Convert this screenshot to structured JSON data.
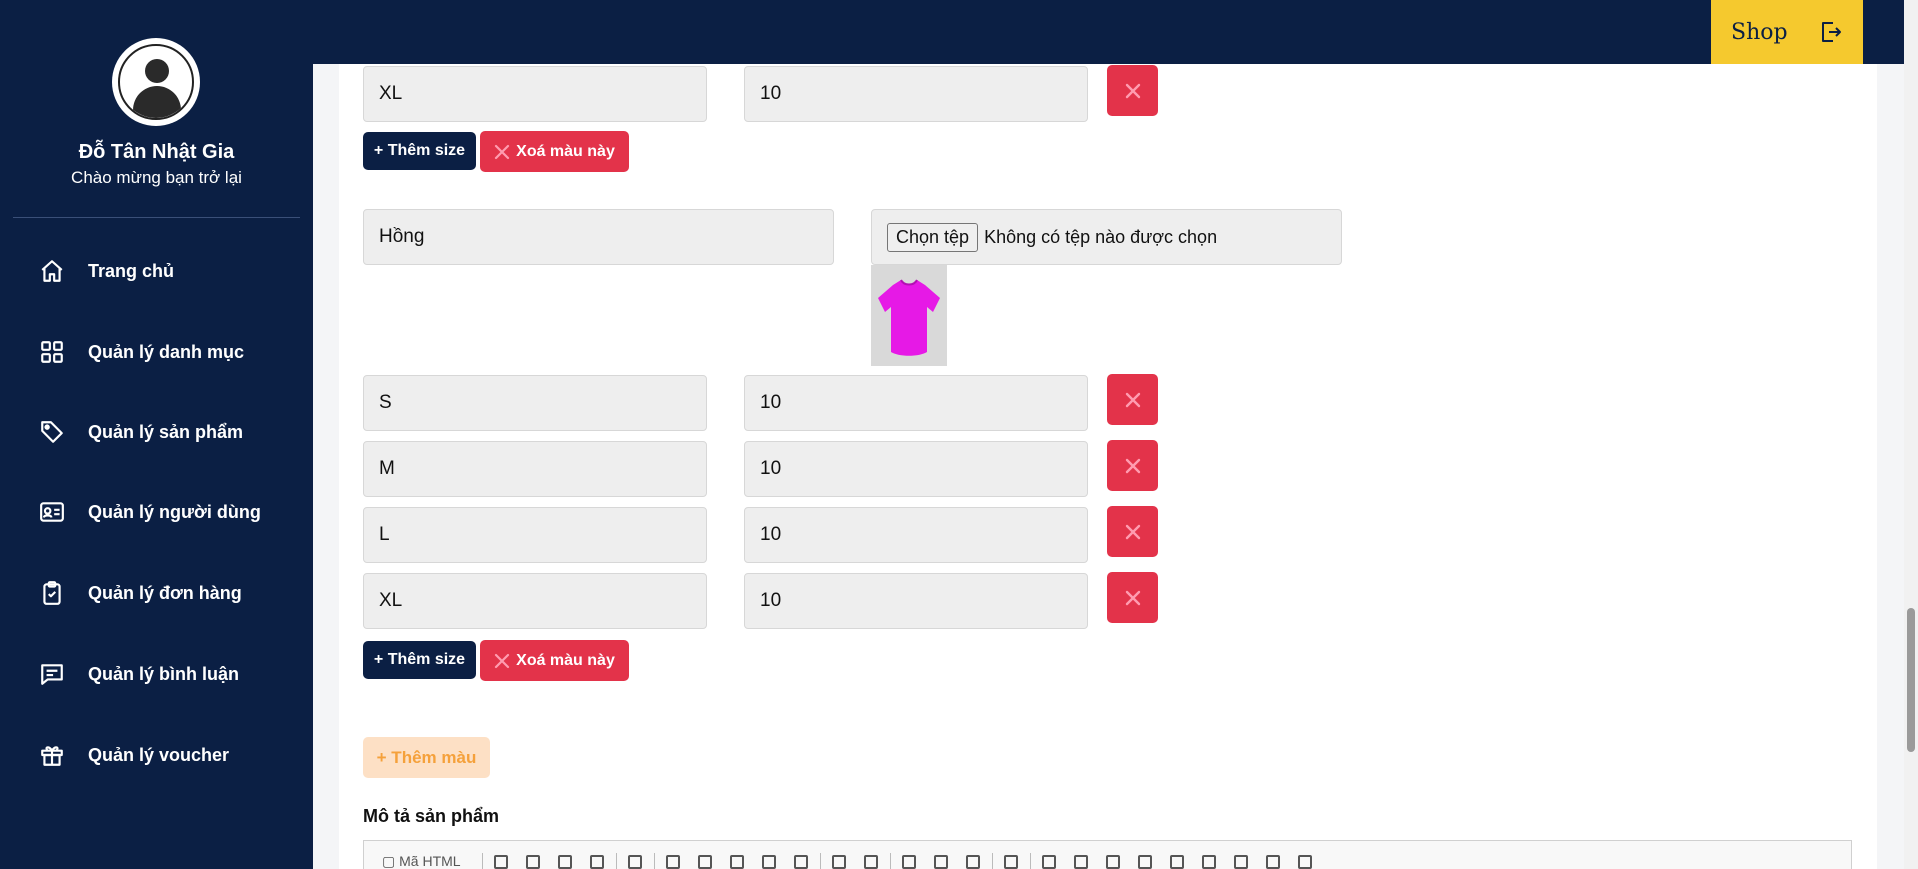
{
  "user": {
    "name": "Đỗ Tân Nhật Gia",
    "welcome": "Chào mừng bạn trở lại"
  },
  "nav": [
    {
      "label": "Trang chủ",
      "icon": "home-icon"
    },
    {
      "label": "Quản lý danh mục",
      "icon": "grid-icon"
    },
    {
      "label": "Quản lý sản phẩm",
      "icon": "tag-icon"
    },
    {
      "label": "Quản lý người dùng",
      "icon": "id-card-icon"
    },
    {
      "label": "Quản lý đơn hàng",
      "icon": "clipboard-check-icon"
    },
    {
      "label": "Quản lý bình luận",
      "icon": "comment-icon"
    },
    {
      "label": "Quản lý voucher",
      "icon": "gift-icon"
    }
  ],
  "topbar": {
    "shop_label": "Shop"
  },
  "color_blocks": [
    {
      "sizes": [
        {
          "size": "XL",
          "qty": "10"
        }
      ],
      "add_size_label": "+ Thêm size",
      "delete_color_label": "Xoá màu này"
    },
    {
      "color_name": "Hồng",
      "file_button": "Chọn tệp",
      "file_status": "Không có tệp nào được chọn",
      "sizes": [
        {
          "size": "S",
          "qty": "10"
        },
        {
          "size": "M",
          "qty": "10"
        },
        {
          "size": "L",
          "qty": "10"
        },
        {
          "size": "XL",
          "qty": "10"
        }
      ],
      "add_size_label": "+ Thêm size",
      "delete_color_label": "Xoá màu này"
    }
  ],
  "add_color_label": "+ Thêm màu",
  "description_label": "Mô tả sản phẩm",
  "editor": {
    "source_label": "Mã HTML"
  },
  "colors": {
    "navy": "#0b1f44",
    "accent_yellow": "#f5c92e",
    "danger": "#e3334a",
    "tshirt": "#e619e6"
  }
}
